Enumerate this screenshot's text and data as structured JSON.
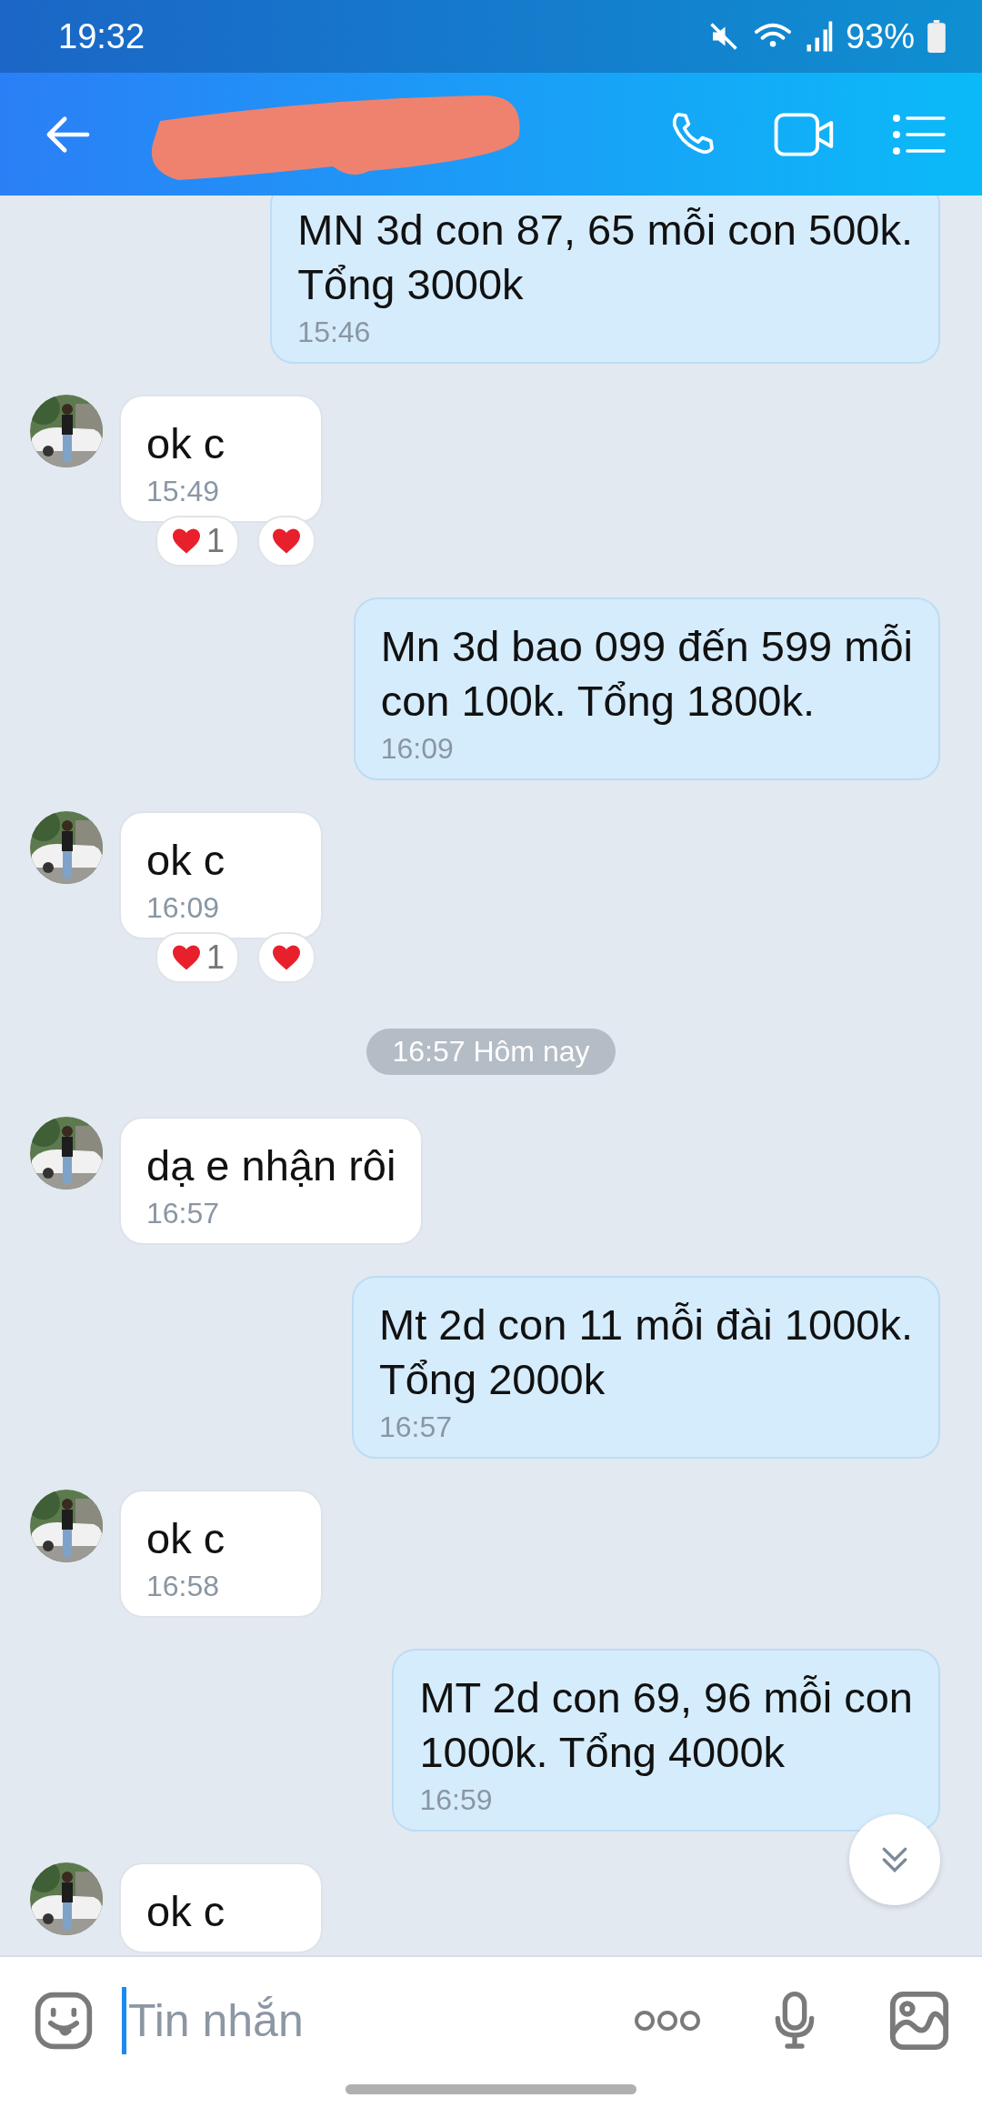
{
  "status_bar": {
    "time": "19:32",
    "battery": "93%"
  },
  "messages": [
    {
      "kind": "sent",
      "text": "MN 3d con 87, 65 mỗi con 500k.\nTổng 3000k",
      "time": "15:46"
    },
    {
      "kind": "received",
      "text": "ok c",
      "time": "15:49",
      "reaction_count": "1"
    },
    {
      "kind": "sent",
      "text": "Mn 3d bao 099 đến 599 mỗi\ncon 100k. Tổng 1800k.",
      "time": "16:09"
    },
    {
      "kind": "received",
      "text": "ok c",
      "time": "16:09",
      "reaction_count": "1"
    },
    {
      "kind": "date",
      "text": "16:57 Hôm nay"
    },
    {
      "kind": "received",
      "text": "dạ e nhận rôi",
      "time": "16:57"
    },
    {
      "kind": "sent",
      "text": "Mt 2d con 11 mỗi đài 1000k.\nTổng 2000k",
      "time": "16:57"
    },
    {
      "kind": "received",
      "text": "ok c",
      "time": "16:58"
    },
    {
      "kind": "sent",
      "text": "MT 2d con 69, 96 mỗi con\n1000k. Tổng 4000k",
      "time": "16:59"
    },
    {
      "kind": "received",
      "text": "ok c"
    }
  ],
  "composer": {
    "placeholder": "Tin nhắn"
  }
}
